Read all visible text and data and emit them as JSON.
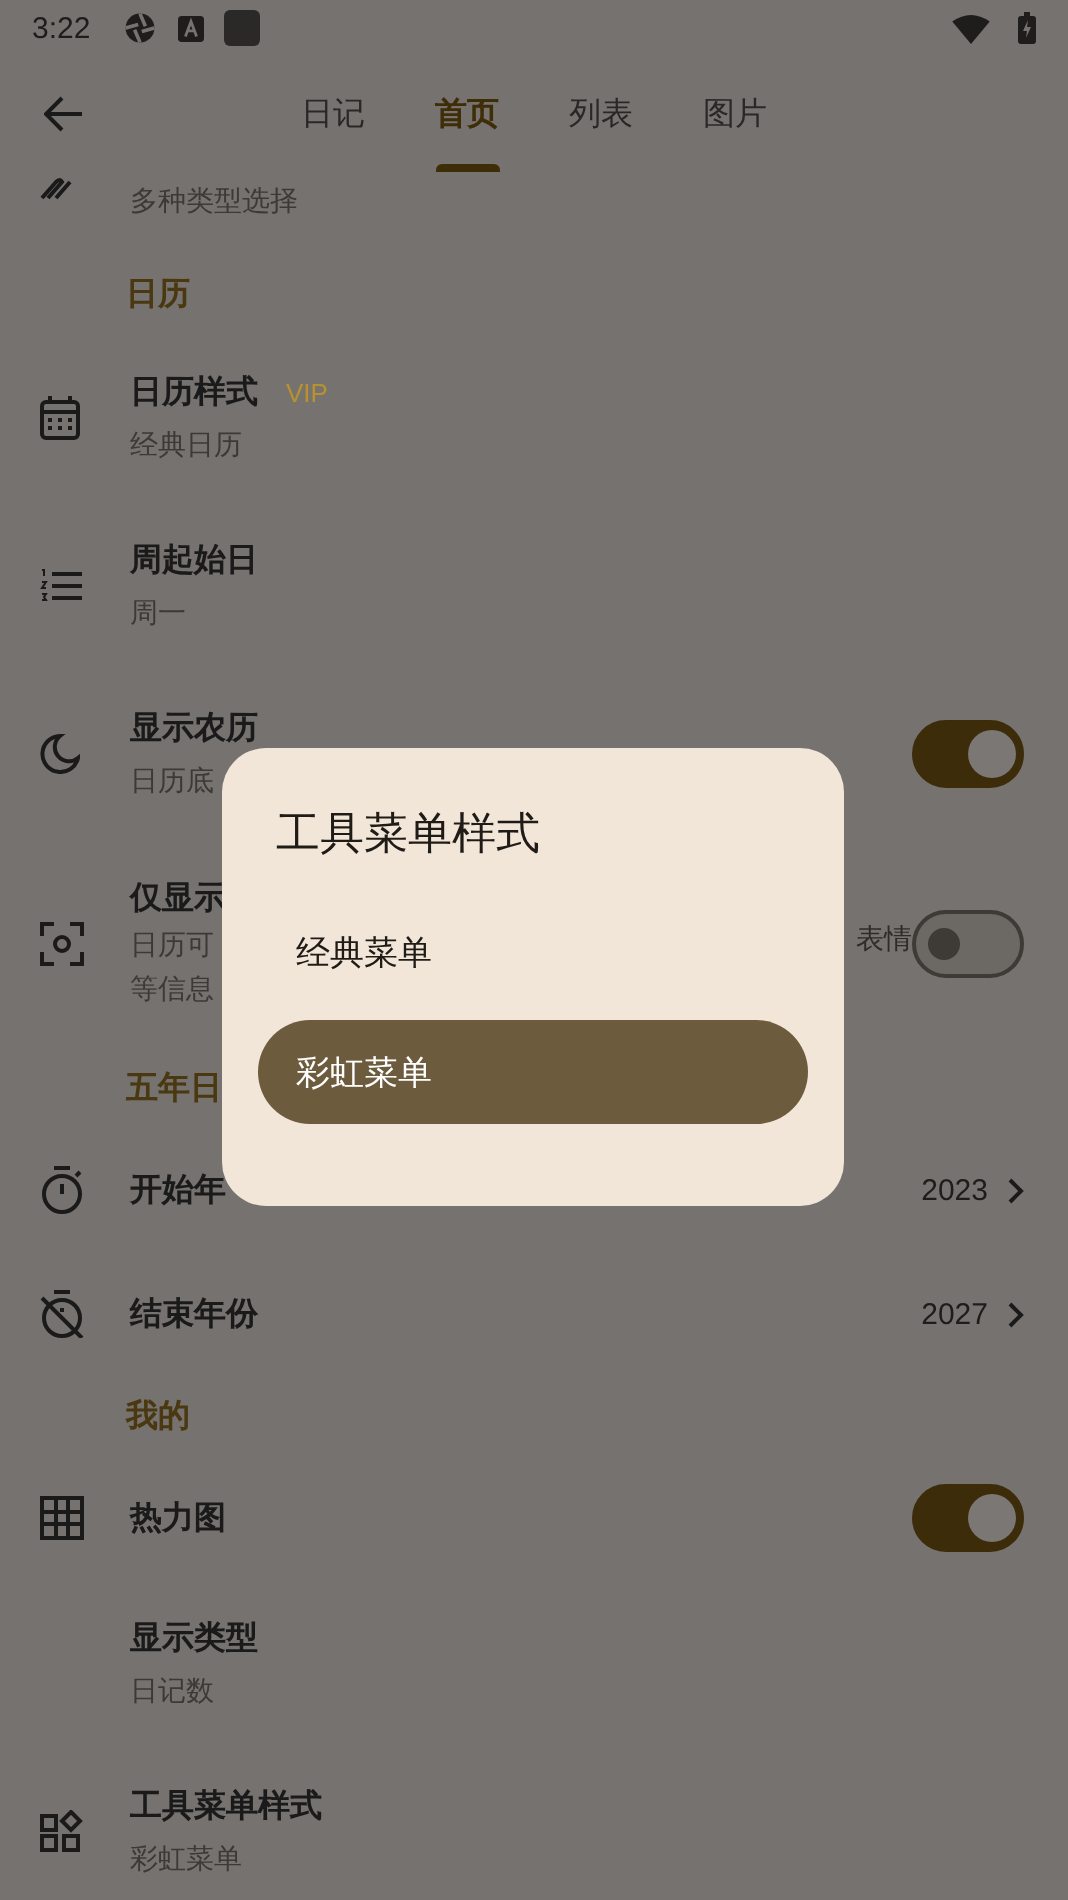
{
  "status_bar": {
    "time": "3:22"
  },
  "tabs": [
    {
      "label": "日记",
      "selected": false
    },
    {
      "label": "首页",
      "selected": true
    },
    {
      "label": "列表",
      "selected": false
    },
    {
      "label": "图片",
      "selected": false
    }
  ],
  "settings": [
    {
      "kind": "partial",
      "subtitle": "多种类型选择"
    },
    {
      "kind": "header",
      "title": "日历"
    },
    {
      "kind": "item",
      "title": "日历样式",
      "badge": "VIP",
      "subtitle": "经典日历"
    },
    {
      "kind": "item",
      "title": "周起始日",
      "subtitle": "周一"
    },
    {
      "kind": "toggle",
      "title": "显示农历",
      "subtitle": "日历底",
      "on": true
    },
    {
      "kind": "toggle",
      "title": "仅显示",
      "subtitle": "日历可",
      "subtitle_end": "表情",
      "subtitle_2": "等信息",
      "on": false
    },
    {
      "kind": "header",
      "title": "五年日"
    },
    {
      "kind": "value",
      "title": "开始年",
      "value": "2023"
    },
    {
      "kind": "value",
      "title": "结束年份",
      "value": "2027"
    },
    {
      "kind": "header",
      "title": "我的"
    },
    {
      "kind": "toggle",
      "title": "热力图",
      "on": true
    },
    {
      "kind": "item",
      "title": "显示类型",
      "subtitle": "日记数"
    },
    {
      "kind": "item",
      "title": "工具菜单样式",
      "subtitle": "彩虹菜单"
    }
  ],
  "dialog": {
    "title": "工具菜单样式",
    "options": [
      {
        "label": "经典菜单",
        "selected": false
      },
      {
        "label": "彩虹菜单",
        "selected": true
      }
    ]
  }
}
